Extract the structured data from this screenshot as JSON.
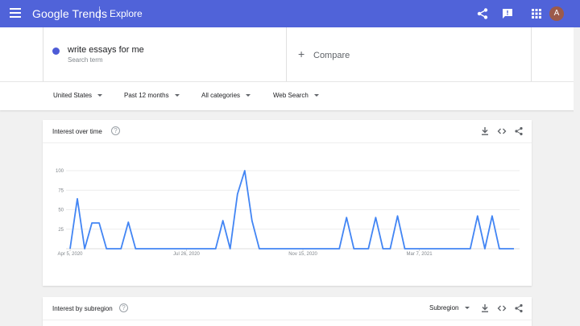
{
  "topbar": {
    "brand_google": "Google",
    "brand_trends": "Trends",
    "page": "Explore",
    "avatar_initial": "A"
  },
  "search": {
    "term": "write essays for me",
    "term_type": "Search term",
    "compare_label": "Compare",
    "term_color": "#4d5bd6"
  },
  "filters": {
    "region": "United States",
    "period": "Past 12 months",
    "category": "All categories",
    "property": "Web Search"
  },
  "interest_over_time": {
    "title": "Interest over time"
  },
  "interest_by_subregion": {
    "title": "Interest by subregion",
    "dropdown": "Subregion"
  },
  "chart_data": {
    "type": "line",
    "title": "Interest over time",
    "xlabel": "",
    "ylabel": "",
    "ylim": [
      0,
      100
    ],
    "yticks": [
      "100",
      "75",
      "50",
      "25"
    ],
    "ytick_values": [
      100,
      75,
      50,
      25
    ],
    "xticks": [
      "Apr 5, 2020",
      "Jul 26, 2020",
      "Nov 15, 2020",
      "Mar 7, 2021"
    ],
    "grid": true,
    "series": [
      {
        "name": "write essays for me",
        "color": "#4285f4",
        "values": [
          0,
          64,
          0,
          33,
          33,
          0,
          0,
          0,
          34,
          0,
          0,
          0,
          0,
          0,
          0,
          0,
          0,
          0,
          0,
          0,
          0,
          36,
          0,
          70,
          100,
          36,
          0,
          0,
          0,
          0,
          0,
          0,
          0,
          0,
          0,
          0,
          0,
          0,
          40,
          0,
          0,
          0,
          40,
          0,
          0,
          42,
          0,
          0,
          0,
          0,
          0,
          0,
          0,
          0,
          0,
          0,
          42,
          0,
          42,
          0,
          0,
          0
        ]
      }
    ]
  }
}
